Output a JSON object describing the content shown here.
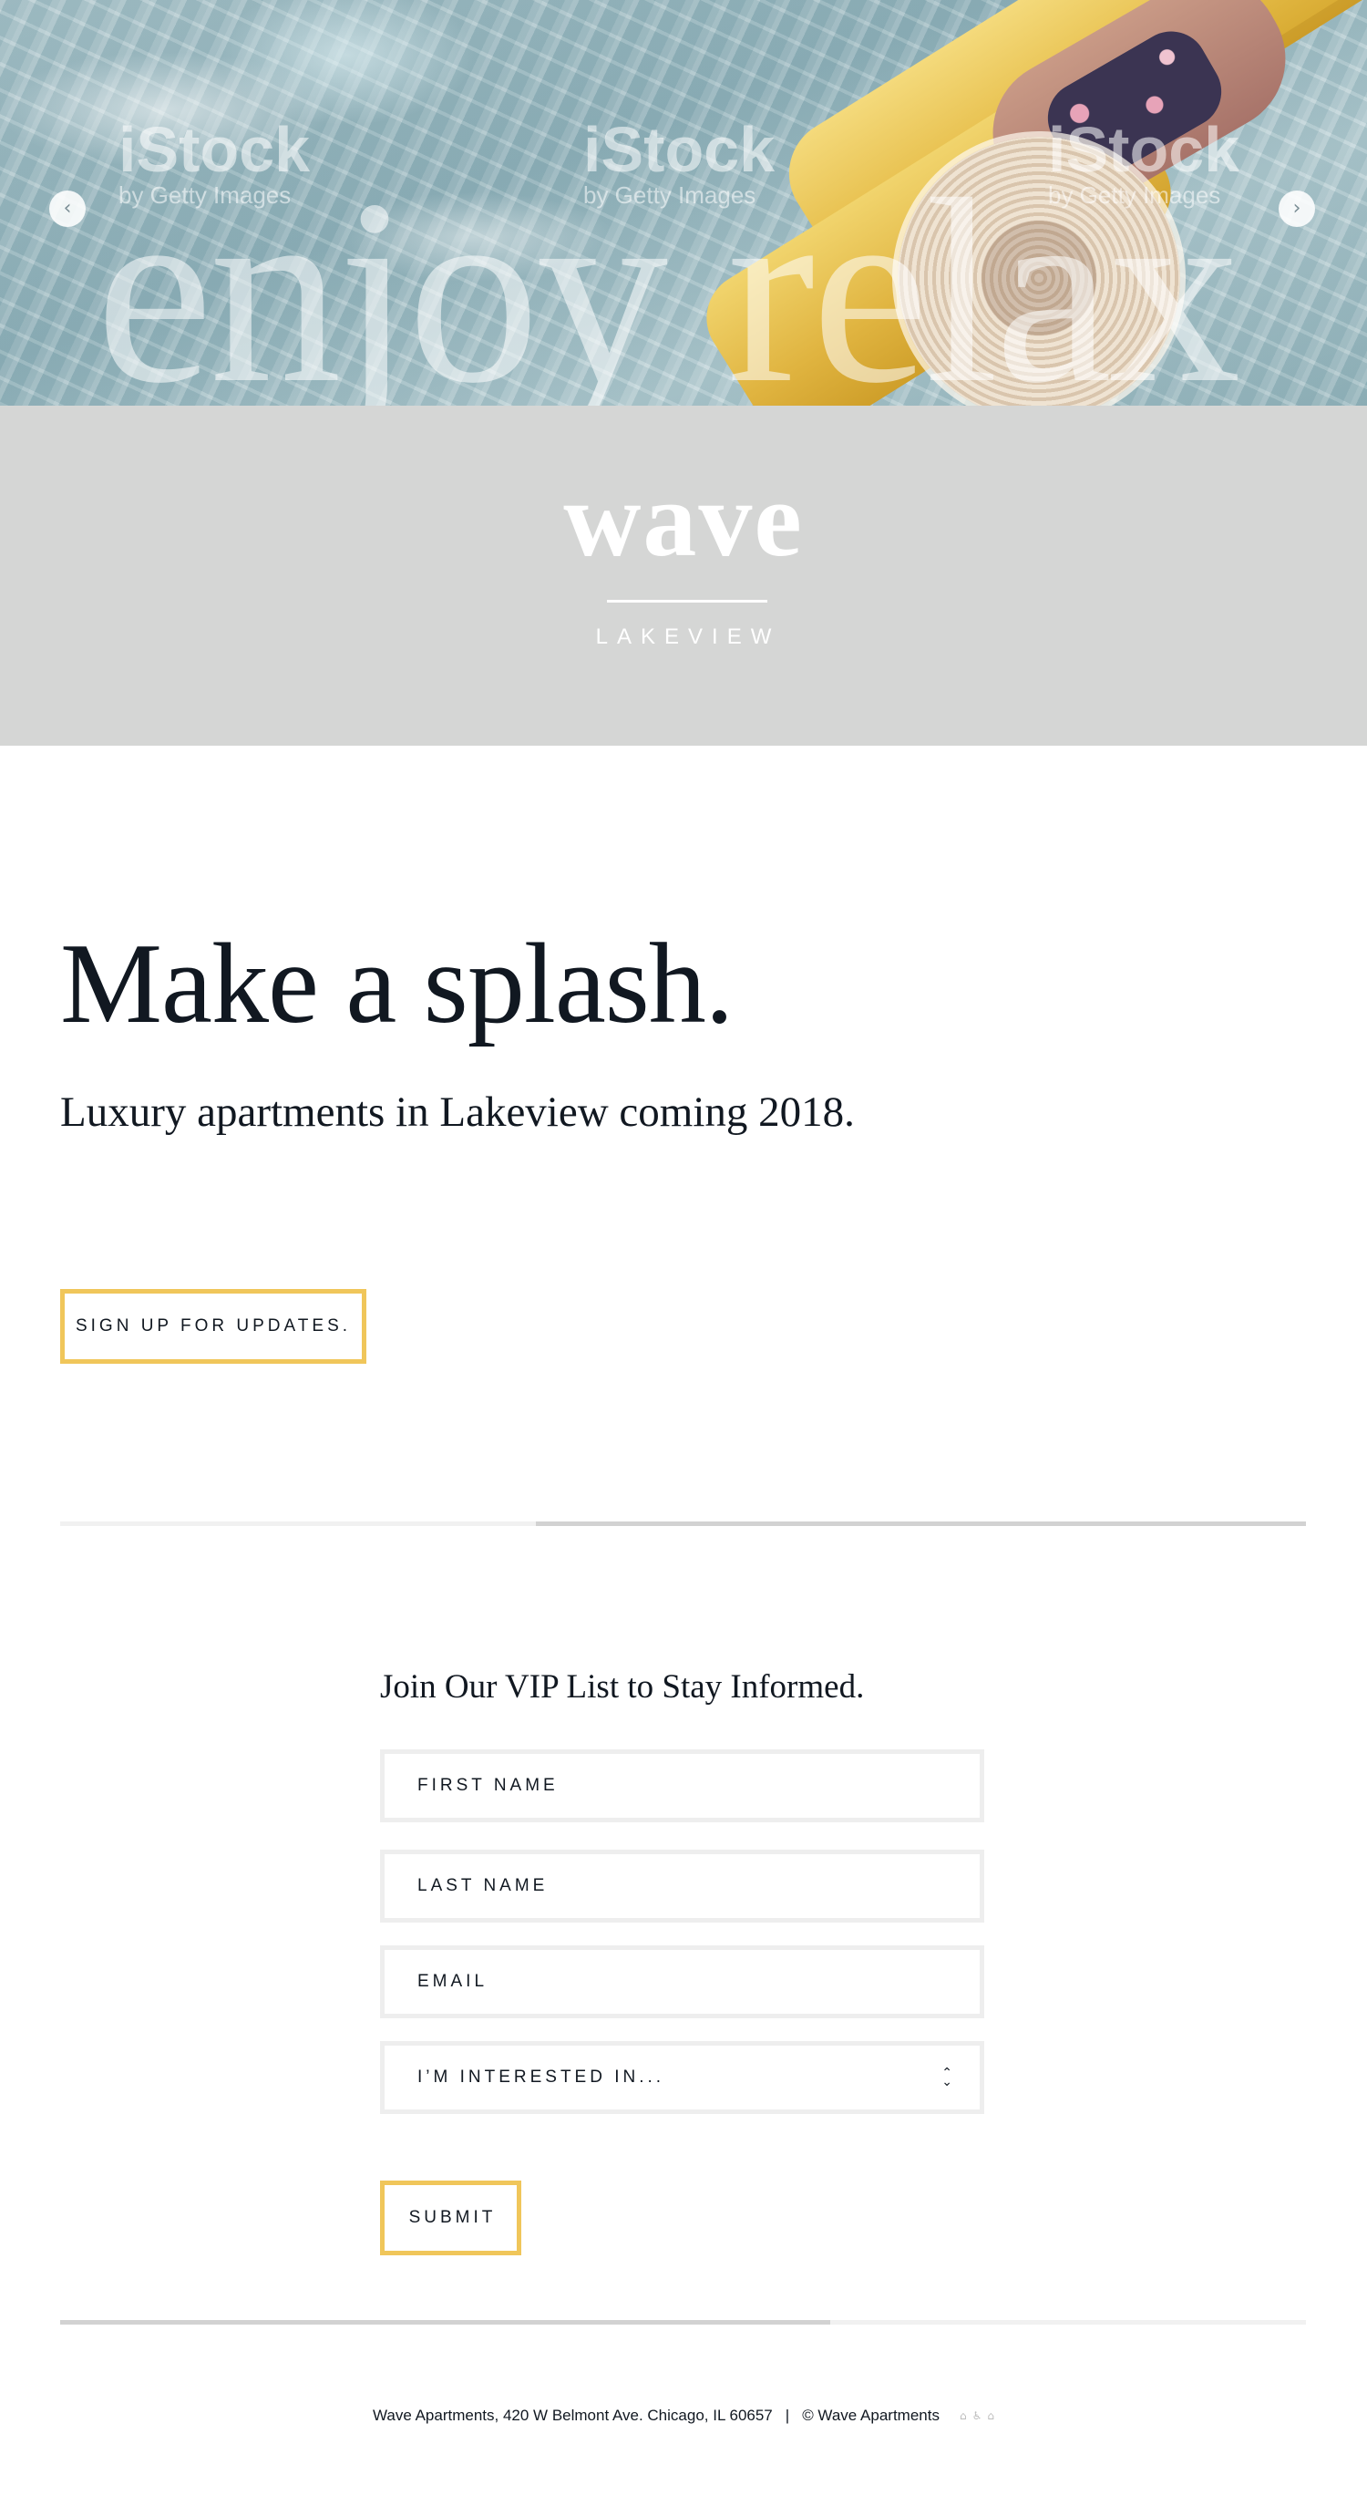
{
  "hero": {
    "overlay_text": "enjoy relax",
    "watermarks": [
      {
        "brand": "iStock",
        "credit": "by Getty Images"
      },
      {
        "brand": "iStock",
        "credit": "by Getty Images"
      },
      {
        "brand": "iStock",
        "credit": "by Getty Images"
      }
    ],
    "prev_icon": "chevron-left-icon",
    "next_icon": "chevron-right-icon"
  },
  "brand": {
    "logo": "wave",
    "location": "LAKEVIEW",
    "band_color": "#d5d6d5"
  },
  "intro": {
    "headline": "Make a splash.",
    "subheadline": "Luxury apartments in Lakeview coming 2018.",
    "cta_label": "SIGN UP FOR UPDATES."
  },
  "form": {
    "title": "Join Our VIP List to Stay Informed.",
    "first_name_placeholder": "FIRST NAME",
    "last_name_placeholder": "LAST NAME",
    "email_placeholder": "EMAIL",
    "interest_label": "I’M INTERESTED IN...",
    "submit_label": "SUBMIT"
  },
  "footer": {
    "address": "Wave Apartments, 420 W Belmont Ave. Chicago, IL 60657",
    "separator": "|",
    "copyright": "© Wave Apartments",
    "icons": [
      "home-icon",
      "accessibility-icon",
      "equal-housing-icon"
    ]
  },
  "colors": {
    "accent": "#f0c65a",
    "text": "#111821",
    "field_border": "#eeeeee",
    "divider_light": "#f1f1f1",
    "divider_dark": "#d2d2d2"
  }
}
